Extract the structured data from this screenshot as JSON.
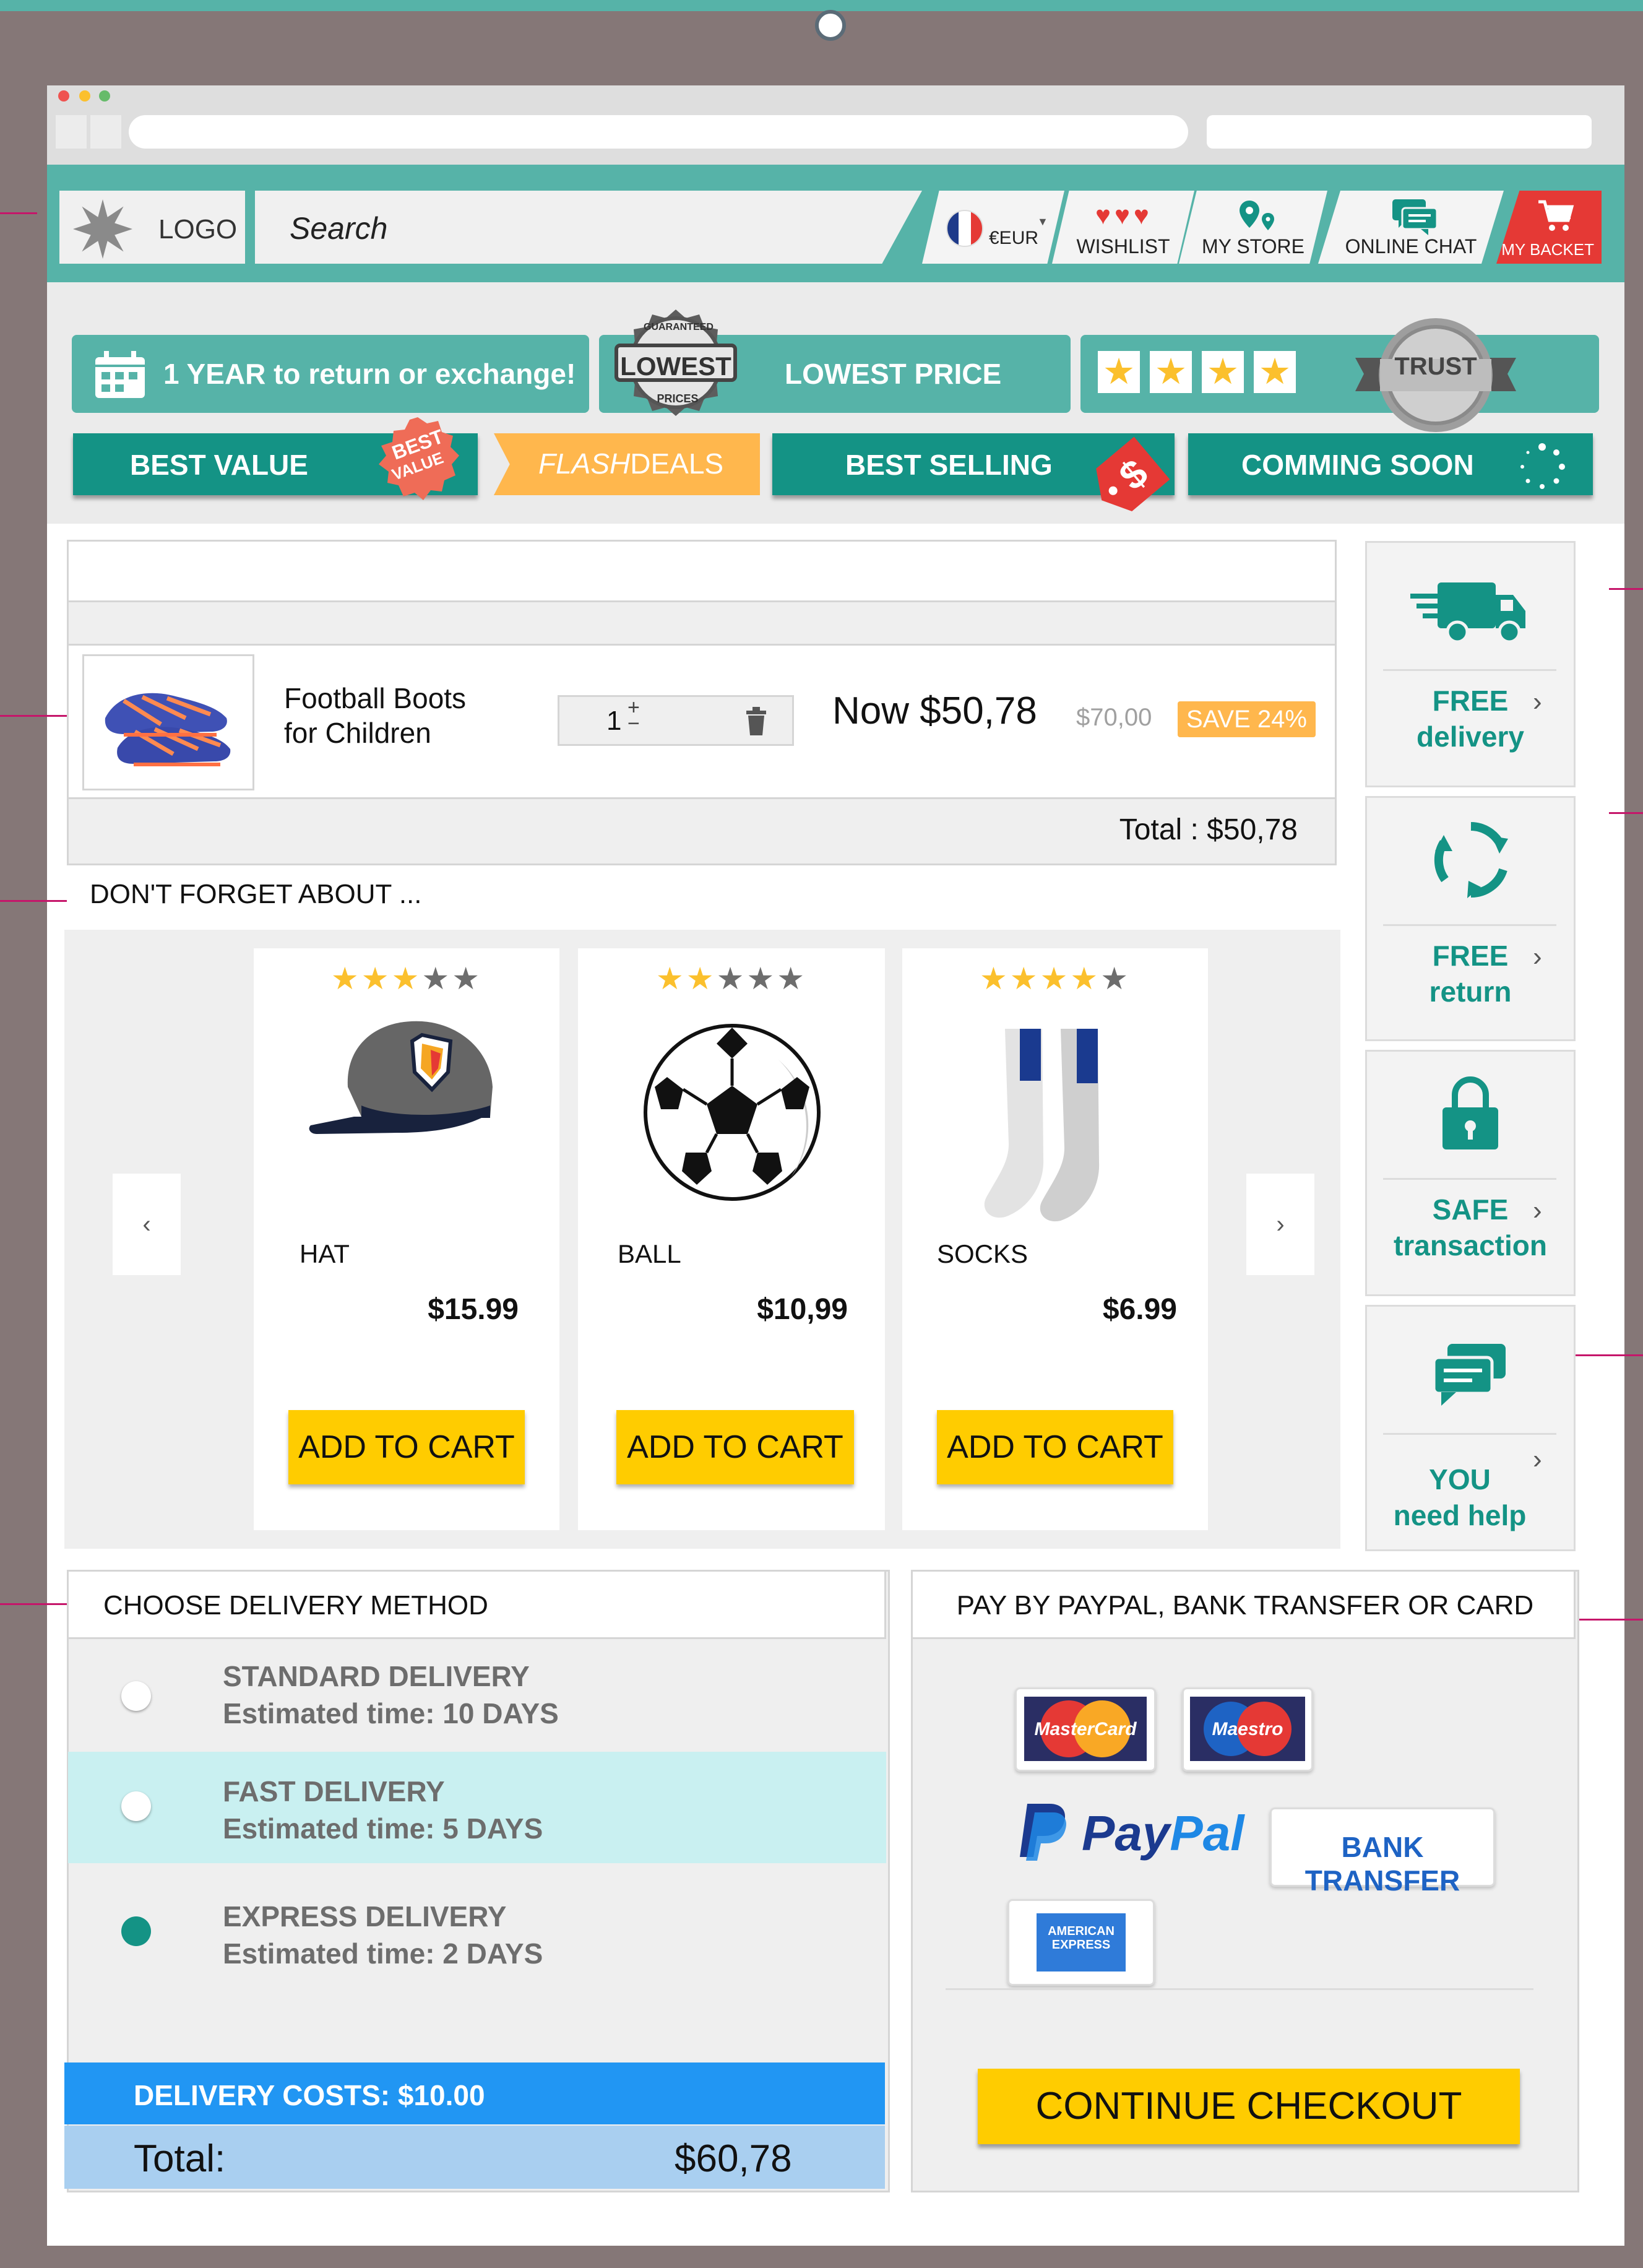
{
  "header": {
    "logo_text": "LOGO",
    "search_placeholder": "Search",
    "currency": "€EUR",
    "wishlist": "WISHLIST",
    "my_store": "MY STORE",
    "online_chat": "ONLINE CHAT",
    "my_basket": "MY BACKET"
  },
  "banners": {
    "return": "1 YEAR to return or exchange!",
    "lowest_badge": "LOWEST",
    "lowest_badge_top": "GUARANTEED",
    "lowest_badge_bottom": "PRICES",
    "lowest_price": "LOWEST PRICE",
    "stars": 4,
    "trust": "TRUST",
    "best_value": "BEST VALUE",
    "best_value_badge_1": "BEST",
    "best_value_badge_2": "VALUE",
    "flash_a": "FLASH",
    "flash_b": "DEALS",
    "best_selling": "BEST SELLING",
    "comming_soon": "COMMING SOON"
  },
  "cart": {
    "item_name_1": "Football Boots",
    "item_name_2": "for Children",
    "quantity": "1",
    "now_price": "Now $50,78",
    "old_price": "$70,00",
    "save": "SAVE 24%",
    "total": "Total : $50,78"
  },
  "suggestions": {
    "heading": "DON'T FORGET ABOUT ...",
    "products": [
      {
        "name": "HAT",
        "price": "$15.99",
        "rating": 3,
        "button": "ADD TO CART"
      },
      {
        "name": "BALL",
        "price": "$10,99",
        "rating": 2,
        "button": "ADD TO CART"
      },
      {
        "name": "SOCKS",
        "price": "$6.99",
        "rating": 4,
        "button": "ADD TO CART"
      }
    ]
  },
  "side": [
    {
      "line1": "FREE",
      "line2": "delivery",
      "icon": "truck-icon"
    },
    {
      "line1": "FREE",
      "line2": "return",
      "icon": "refresh-icon"
    },
    {
      "line1": "SAFE",
      "line2": "transaction",
      "icon": "lock-icon"
    },
    {
      "line1": "YOU",
      "line2": "need help",
      "icon": "chat-icon"
    }
  ],
  "delivery": {
    "heading": "CHOOSE DELIVERY METHOD",
    "options": [
      {
        "name": "STANDARD DELIVERY",
        "time": "Estimated time: 10 DAYS",
        "selected": false
      },
      {
        "name": "FAST DELIVERY",
        "time": "Estimated time: 5 DAYS",
        "selected": false
      },
      {
        "name": "EXPRESS DELIVERY",
        "time": "Estimated time: 2 DAYS",
        "selected": true
      }
    ],
    "costs": "DELIVERY COSTS: $10.00",
    "total_label": "Total:",
    "total_value": "$60,78"
  },
  "payment": {
    "heading": "PAY BY PAYPAL, BANK TRANSFER OR CARD",
    "mastercard": "MasterCard",
    "maestro": "Maestro",
    "paypal_a": "Pay",
    "paypal_b": "Pal",
    "bank": "BANK TRANSFER",
    "amex": "AMERICAN EXPRESS",
    "continue": "CONTINUE CHECKOUT"
  },
  "colors": {
    "teal": "#56b3a8",
    "dark_teal": "#149385",
    "yellow": "#ffcc00",
    "orange": "#ffb74d",
    "blue": "#2196f3",
    "light_blue": "#a9cff0",
    "highlight": "#c9f0f1",
    "red": "#e53935"
  }
}
